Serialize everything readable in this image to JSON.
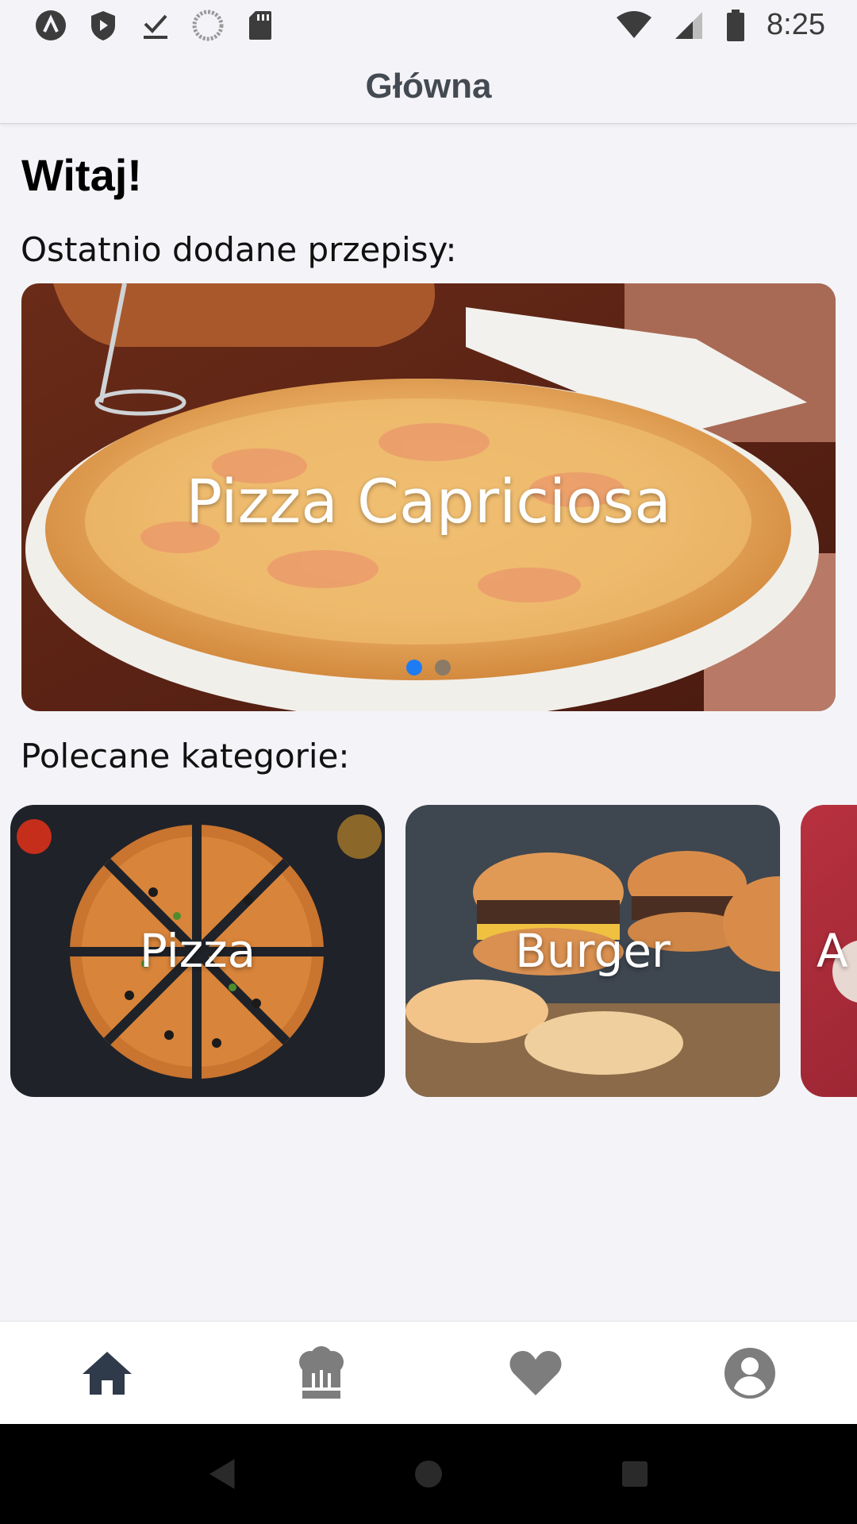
{
  "status_bar": {
    "time": "8:25",
    "left_icons": [
      "app-a-icon",
      "shield-icon",
      "download-done-icon",
      "sync-circle-icon",
      "sd-card-icon"
    ],
    "right_icons": [
      "wifi-icon",
      "signal-icon",
      "battery-icon"
    ]
  },
  "header": {
    "title": "Główna"
  },
  "main": {
    "greeting": "Witaj!",
    "recent_label": "Ostatnio dodane przepisy:",
    "carousel": {
      "slides": [
        {
          "title": "Pizza Capriciosa"
        }
      ],
      "dots": {
        "count": 2,
        "active_index": 0,
        "active_color": "#1e7cf2",
        "inactive_color": "#8a7a66"
      }
    },
    "categories_label": "Polecane kategorie:",
    "categories": [
      {
        "label": "Pizza"
      },
      {
        "label": "Burger"
      },
      {
        "label": "A"
      }
    ]
  },
  "tabbar": {
    "tabs": [
      {
        "icon": "home-icon",
        "active": true
      },
      {
        "icon": "chef-hat-icon",
        "active": false
      },
      {
        "icon": "heart-icon",
        "active": false
      },
      {
        "icon": "user-circle-icon",
        "active": false
      }
    ],
    "active_color": "#2f3a4a",
    "inactive_color": "#7d7d7d"
  },
  "nav_bar": {
    "buttons": [
      "back-icon",
      "home-circle-icon",
      "recents-icon"
    ]
  }
}
